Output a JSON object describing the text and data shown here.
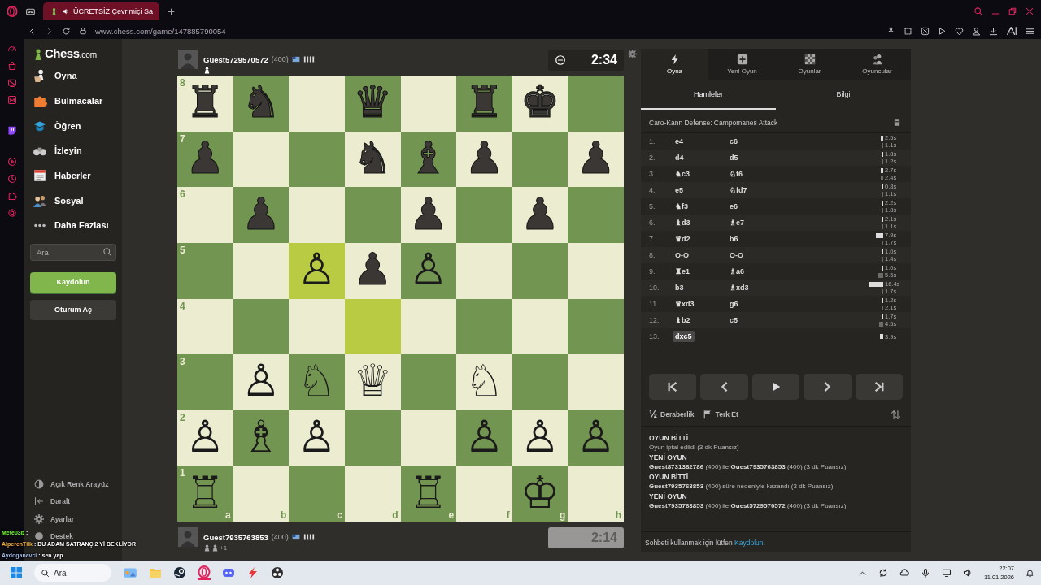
{
  "browser": {
    "tab": {
      "title": "ÜCRETSİZ Çevrimiçi Sa",
      "selected": true
    },
    "url": "www.chess.com/game/147885790054"
  },
  "sidebar": {
    "logo": {
      "name": "Chess",
      "suffix": ".com"
    },
    "nav": [
      {
        "label": "Oyna",
        "kind": "play"
      },
      {
        "label": "Bulmacalar",
        "kind": "puzzles"
      },
      {
        "label": "Öğren",
        "kind": "learn"
      },
      {
        "label": "İzleyin",
        "kind": "watch"
      },
      {
        "label": "Haberler",
        "kind": "news"
      },
      {
        "label": "Sosyal",
        "kind": "social"
      },
      {
        "label": "Daha Fazlası",
        "kind": "more"
      }
    ],
    "search": {
      "placeholder": "Ara"
    },
    "buttons": [
      {
        "label": "Kaydolun",
        "kind": "primary"
      },
      {
        "label": "Oturum Aç",
        "kind": "secondary"
      }
    ],
    "footer": [
      {
        "label": "Açık Renk Arayüz",
        "kind": "theme"
      },
      {
        "label": "Daralt",
        "kind": "collapse"
      },
      {
        "label": "Ayarlar",
        "kind": "settings"
      },
      {
        "label": "Destek",
        "kind": "support"
      }
    ]
  },
  "top_player": {
    "name": "Guest5729570572",
    "rating": "(400)",
    "clock": "2:34",
    "active": true
  },
  "board": {
    "rank_labels": [
      "8",
      "7",
      "6",
      "5",
      "4",
      "3",
      "2",
      "1"
    ],
    "file_labels": [
      "a",
      "b",
      "c",
      "d",
      "e",
      "f",
      "g",
      "h"
    ],
    "ranks": [
      [
        {
          "piece": "♜",
          "white": false,
          "highlighted": false
        },
        {
          "piece": "♞",
          "white": false,
          "highlighted": false
        },
        {
          "highlighted": false
        },
        {
          "piece": "♛",
          "white": false,
          "highlighted": false
        },
        {
          "highlighted": false
        },
        {
          "piece": "♜",
          "white": false,
          "highlighted": false
        },
        {
          "piece": "♚",
          "white": false,
          "highlighted": false
        },
        {
          "highlighted": false
        }
      ],
      [
        {
          "piece": "♟",
          "white": false,
          "highlighted": false
        },
        {
          "highlighted": false
        },
        {
          "highlighted": false
        },
        {
          "piece": "♞",
          "white": false,
          "highlighted": false
        },
        {
          "piece": "♝",
          "white": false,
          "highlighted": false
        },
        {
          "piece": "♟",
          "white": false,
          "highlighted": false
        },
        {
          "highlighted": false
        },
        {
          "piece": "♟",
          "white": false,
          "highlighted": false
        }
      ],
      [
        {
          "highlighted": false
        },
        {
          "piece": "♟",
          "white": false,
          "highlighted": false
        },
        {
          "highlighted": false
        },
        {
          "highlighted": false
        },
        {
          "piece": "♟",
          "white": false,
          "highlighted": false
        },
        {
          "highlighted": false
        },
        {
          "piece": "♟",
          "white": false,
          "highlighted": false
        },
        {
          "highlighted": false
        }
      ],
      [
        {
          "highlighted": false
        },
        {
          "highlighted": false
        },
        {
          "piece": "♙",
          "white": true,
          "highlighted": true
        },
        {
          "piece": "♟",
          "white": false,
          "highlighted": false
        },
        {
          "piece": "♙",
          "white": true,
          "highlighted": false
        },
        {
          "highlighted": false
        },
        {
          "highlighted": false
        },
        {
          "highlighted": false
        }
      ],
      [
        {
          "highlighted": false
        },
        {
          "highlighted": false
        },
        {
          "highlighted": false
        },
        {
          "highlighted": true
        },
        {
          "highlighted": false
        },
        {
          "highlighted": false
        },
        {
          "highlighted": false
        },
        {
          "highlighted": false
        }
      ],
      [
        {
          "highlighted": false
        },
        {
          "piece": "♙",
          "white": true,
          "highlighted": false
        },
        {
          "piece": "♘",
          "white": true,
          "highlighted": false
        },
        {
          "piece": "♕",
          "white": true,
          "highlighted": false
        },
        {
          "highlighted": false
        },
        {
          "piece": "♘",
          "white": true,
          "highlighted": false
        },
        {
          "highlighted": false
        },
        {
          "highlighted": false
        }
      ],
      [
        {
          "piece": "♙",
          "white": true,
          "highlighted": false
        },
        {
          "piece": "♗",
          "white": true,
          "highlighted": false
        },
        {
          "piece": "♙",
          "white": true,
          "highlighted": false
        },
        {
          "highlighted": false
        },
        {
          "highlighted": false
        },
        {
          "piece": "♙",
          "white": true,
          "highlighted": false
        },
        {
          "piece": "♙",
          "white": true,
          "highlighted": false
        },
        {
          "piece": "♙",
          "white": true,
          "highlighted": false
        }
      ],
      [
        {
          "piece": "♖",
          "white": true,
          "highlighted": false
        },
        {
          "highlighted": false
        },
        {
          "highlighted": false
        },
        {
          "highlighted": false
        },
        {
          "piece": "♖",
          "white": true,
          "highlighted": false
        },
        {
          "highlighted": false
        },
        {
          "piece": "♔",
          "white": true,
          "highlighted": false
        },
        {
          "highlighted": false
        }
      ]
    ]
  },
  "bottom_player": {
    "name": "Guest7935763853",
    "rating": "(400)",
    "advantage": "+1",
    "clock": "2:14",
    "active": false
  },
  "panel": {
    "tabs": [
      {
        "label": "Oyna",
        "kind": "play",
        "selected": true
      },
      {
        "label": "Yeni Oyun",
        "kind": "new_game",
        "selected": false
      },
      {
        "label": "Oyunlar",
        "kind": "games",
        "selected": false
      },
      {
        "label": "Oyuncular",
        "kind": "players",
        "selected": false
      }
    ],
    "subtabs": [
      {
        "label": "Hamleler",
        "selected": true
      },
      {
        "label": "Bilgi",
        "selected": false
      }
    ],
    "opening": "Caro-Kann Defense: Campomanes Attack",
    "moves": [
      {
        "number": "1.",
        "white": {
          "san": "e4",
          "selected": false
        },
        "black": {
          "san": "c6",
          "selected": false
        },
        "white_time": "2.5s",
        "black_time": "1.1s"
      },
      {
        "number": "2.",
        "white": {
          "san": "d4",
          "selected": false
        },
        "black": {
          "san": "d5",
          "selected": false
        },
        "white_time": "1.8s",
        "black_time": "1.2s"
      },
      {
        "number": "3.",
        "white": {
          "san": "♞c3",
          "selected": false
        },
        "black": {
          "san": "♘f6",
          "selected": false
        },
        "white_time": "2.7s",
        "black_time": "2.4s"
      },
      {
        "number": "4.",
        "white": {
          "san": "e5",
          "selected": false
        },
        "black": {
          "san": "♘fd7",
          "selected": false
        },
        "white_time": "0.8s",
        "black_time": "1.1s"
      },
      {
        "number": "5.",
        "white": {
          "san": "♞f3",
          "selected": false
        },
        "black": {
          "san": "e6",
          "selected": false
        },
        "white_time": "2.2s",
        "black_time": "1.8s"
      },
      {
        "number": "6.",
        "white": {
          "san": "♝d3",
          "selected": false
        },
        "black": {
          "san": "♗e7",
          "selected": false
        },
        "white_time": "2.1s",
        "black_time": "1.1s"
      },
      {
        "number": "7.",
        "white": {
          "san": "♛d2",
          "selected": false
        },
        "black": {
          "san": "b6",
          "selected": false
        },
        "white_time": "7.9s",
        "black_time": "1.7s"
      },
      {
        "number": "8.",
        "white": {
          "san": "O-O",
          "selected": false
        },
        "black": {
          "san": "O-O",
          "selected": false
        },
        "white_time": "1.0s",
        "black_time": "1.4s"
      },
      {
        "number": "9.",
        "white": {
          "san": "♜e1",
          "selected": false
        },
        "black": {
          "san": "♗a6",
          "selected": false
        },
        "white_time": "1.0s",
        "black_time": "5.5s"
      },
      {
        "number": "10.",
        "white": {
          "san": "b3",
          "selected": false
        },
        "black": {
          "san": "♗xd3",
          "selected": false
        },
        "white_time": "16.4s",
        "black_time": "1.7s"
      },
      {
        "number": "11.",
        "white": {
          "san": "♛xd3",
          "selected": false
        },
        "black": {
          "san": "g6",
          "selected": false
        },
        "white_time": "1.2s",
        "black_time": "2.1s"
      },
      {
        "number": "12.",
        "white": {
          "san": "♝b2",
          "selected": false
        },
        "black": {
          "san": "c5",
          "selected": false
        },
        "white_time": "1.7s",
        "black_time": "4.5s"
      },
      {
        "number": "13.",
        "white": {
          "san": "dxc5",
          "selected": true
        },
        "white_time": "3.9s"
      }
    ],
    "draw": {
      "icon": "½",
      "label": "Beraberlik"
    },
    "resign": {
      "label": "Terk Et"
    },
    "chat": [
      {
        "kind": "header",
        "text": "OYUN BİTTİ"
      },
      {
        "kind": "line",
        "text": "Oyun iptal edildi (3 dk Puansız)"
      },
      {
        "kind": "header",
        "text": "YENİ OYUN"
      },
      {
        "kind": "line",
        "text": "**Guest8731382786** (400) ile **Guest7935763853** (400) (3 dk Puansız)"
      },
      {
        "kind": "header",
        "text": "OYUN BİTTİ"
      },
      {
        "kind": "line",
        "text": "**Guest7935763853** (400) süre nedeniyle kazandı (3 dk Puansız)"
      },
      {
        "kind": "header",
        "text": "YENİ OYUN"
      },
      {
        "kind": "line",
        "text": "**Guest7935763853** (400) ile **Guest5729570572** (400) (3 dk Puansız)"
      }
    ],
    "chat_prompt": {
      "text": "Sohbeti kullanmak için lütfen ",
      "link": "Kaydolun",
      "end": "."
    }
  },
  "stream_chat": [
    {
      "user": "Mete03b",
      "message": ":",
      "color": "#7cfc3c"
    },
    {
      "user": "AlperenTilk",
      "message": ": BU ADAM SATRANÇ 2 Yİ BEKLİYOR",
      "color": "#f5b041"
    },
    {
      "user": "Aydoganavci",
      "message": ": sen yap",
      "color": "#9fb6e0"
    }
  ],
  "taskbar": {
    "search_placeholder": "Ara",
    "time": "22:07",
    "date": "11.01.2026"
  }
}
